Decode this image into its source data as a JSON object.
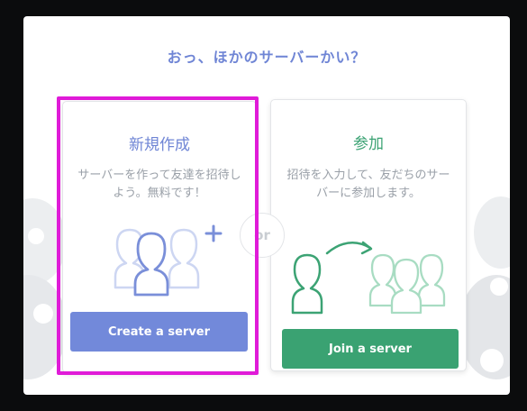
{
  "modal": {
    "title": "おっ、ほかのサーバーかい？"
  },
  "create_card": {
    "title": "新規作成",
    "description": "サーバーを作って友達を招待しよう。無料です！",
    "button_label": "Create a server",
    "accent_color": "#7289da",
    "icon": "add-users-icon"
  },
  "join_card": {
    "title": "参加",
    "description": "招待を入力して、友だちのサーバーに参加します。",
    "button_label": "Join a server",
    "accent_color": "#3aa272",
    "icon": "join-users-icon"
  },
  "divider": {
    "label": "or"
  },
  "colors": {
    "highlight": "#e01bd8",
    "title": "#6f85d5",
    "join_green": "#3ca374"
  }
}
